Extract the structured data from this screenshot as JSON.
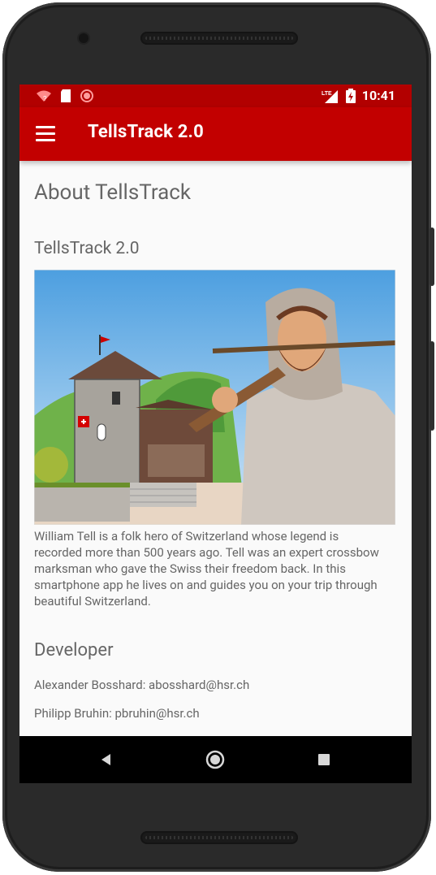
{
  "status_bar": {
    "time": "10:41",
    "network": "LTE",
    "left_icons": [
      "wifi-question-icon",
      "sd-card-icon",
      "record-circle-icon"
    ],
    "right_icons": [
      "signal-lte-icon",
      "battery-charging-icon"
    ]
  },
  "app_bar": {
    "menu_icon": "hamburger-menu-icon",
    "title": "TellsTrack 2.0"
  },
  "about": {
    "heading": "About TellsTrack",
    "version_heading": "TellsTrack 2.0",
    "description": "William Tell is a folk hero of Switzerland whose legend is recorded more than 500 years ago. Tell was an expert crossbow marksman who gave the Swiss their freedom back. In this smartphone app he lives on and guides you on your trip through beautiful Switzerland."
  },
  "developer": {
    "heading": "Developer",
    "entries": [
      "Alexander Bosshard: abosshard@hsr.ch",
      "Philipp Bruhin: pbruhin@hsr.ch"
    ]
  },
  "nav_bar": {
    "buttons": [
      "back-icon",
      "home-icon",
      "recents-icon"
    ]
  },
  "colors": {
    "primary": "#c20000",
    "primary_dark": "#b20000",
    "text_secondary": "#666666",
    "background": "#fafafa"
  }
}
